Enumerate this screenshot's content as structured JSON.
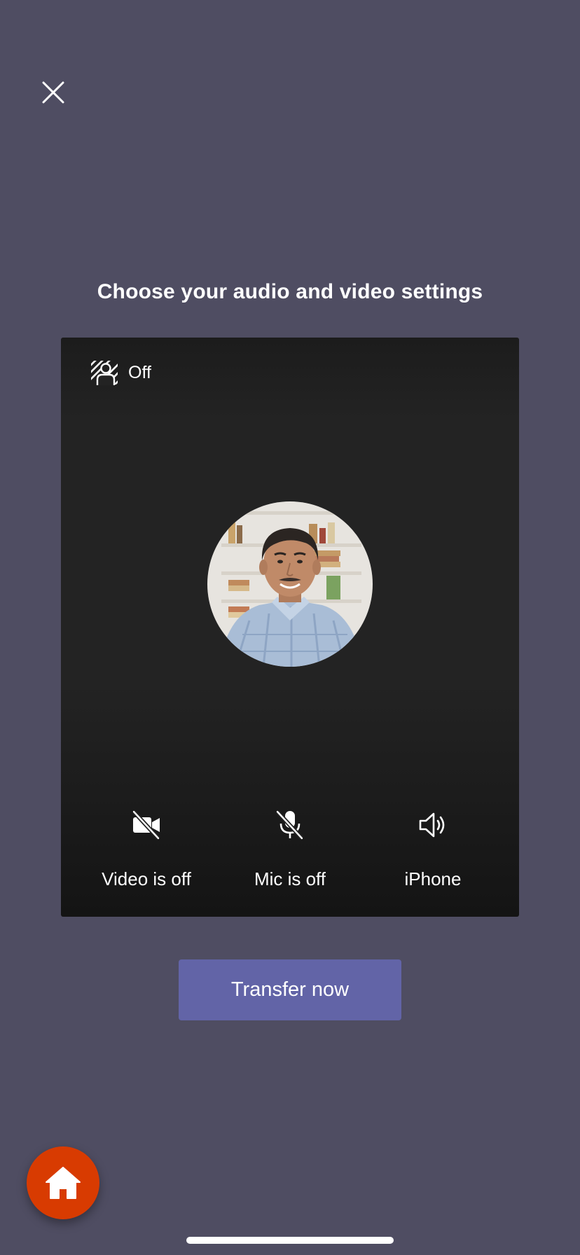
{
  "header": {
    "close_icon": "close-icon"
  },
  "heading": "Choose your audio and video settings",
  "preview": {
    "background_effects": {
      "icon": "background-effects-icon",
      "label": "Off"
    },
    "avatar": {
      "description_icon": "user-avatar"
    },
    "controls": [
      {
        "icon": "video-off-icon",
        "label": "Video is off"
      },
      {
        "icon": "mic-off-icon",
        "label": "Mic is off"
      },
      {
        "icon": "speaker-icon",
        "label": "iPhone"
      }
    ]
  },
  "actions": {
    "transfer_label": "Transfer now"
  },
  "fab": {
    "icon": "home-icon",
    "color": "#d83b01"
  },
  "colors": {
    "background": "#4f4d62",
    "accent": "#6264a7",
    "panel": "#232323"
  }
}
